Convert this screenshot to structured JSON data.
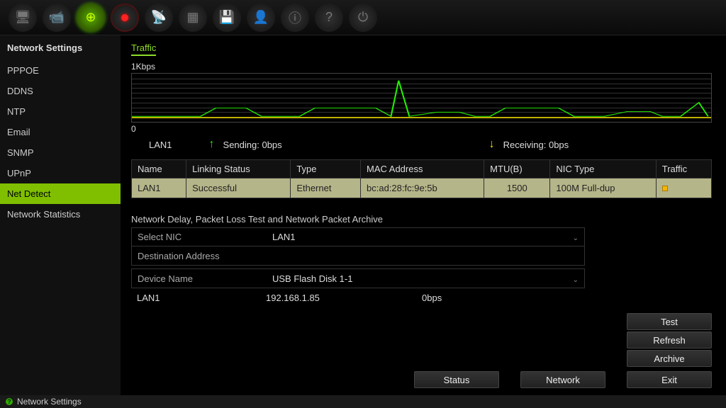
{
  "toolbar_icons": [
    "monitor",
    "camera",
    "network",
    "record",
    "alarm",
    "sensor",
    "storage",
    "user",
    "info",
    "help",
    "power"
  ],
  "sidebar": {
    "heading": "Network Settings",
    "items": [
      "PPPOE",
      "DDNS",
      "NTP",
      "Email",
      "SNMP",
      "UPnP",
      "Net Detect",
      "Network Statistics"
    ],
    "active": "Net Detect"
  },
  "tab_title": "Traffic",
  "chart": {
    "y_max_label": "1Kbps",
    "y_min_label": "0",
    "lan_label": "LAN1",
    "sending_label": "Sending: 0bps",
    "receiving_label": "Receiving: 0bps"
  },
  "chart_data": {
    "type": "line",
    "title": "Traffic",
    "xlabel": "",
    "ylabel": "Kbps",
    "ylim": [
      0,
      1
    ],
    "series": [
      {
        "name": "Sending",
        "color": "#2e0",
        "values": [
          0,
          0,
          0,
          0,
          0,
          0,
          0,
          0.2,
          0.2,
          0,
          0,
          0,
          0,
          0.2,
          0.2,
          0.2,
          0,
          0.9,
          0,
          0.1,
          0.1,
          0,
          0,
          0.2,
          0.2,
          0.2,
          0,
          0,
          0,
          0,
          0,
          0.1,
          0.1,
          0,
          0,
          0,
          0.3,
          0
        ]
      }
    ]
  },
  "table": {
    "headers": [
      "Name",
      "Linking Status",
      "Type",
      "MAC Address",
      "MTU(B)",
      "NIC Type",
      "Traffic"
    ],
    "rows": [
      {
        "name": "LAN1",
        "status": "Successful",
        "type": "Ethernet",
        "mac": "bc:ad:28:fc:9e:5b",
        "mtu": "1500",
        "nic": "100M Full-dup"
      }
    ]
  },
  "test_section": {
    "title": "Network Delay, Packet Loss Test and Network Packet Archive",
    "select_nic_label": "Select NIC",
    "select_nic_value": "LAN1",
    "dest_label": "Destination Address",
    "dest_value": "",
    "device_label": "Device Name",
    "device_value": "USB Flash Disk 1-1",
    "info_lan": "LAN1",
    "info_ip": "192.168.1.85",
    "info_rate": "0bps"
  },
  "buttons": {
    "test": "Test",
    "refresh": "Refresh",
    "archive": "Archive",
    "status": "Status",
    "network": "Network",
    "exit": "Exit"
  },
  "footer": "Network Settings"
}
